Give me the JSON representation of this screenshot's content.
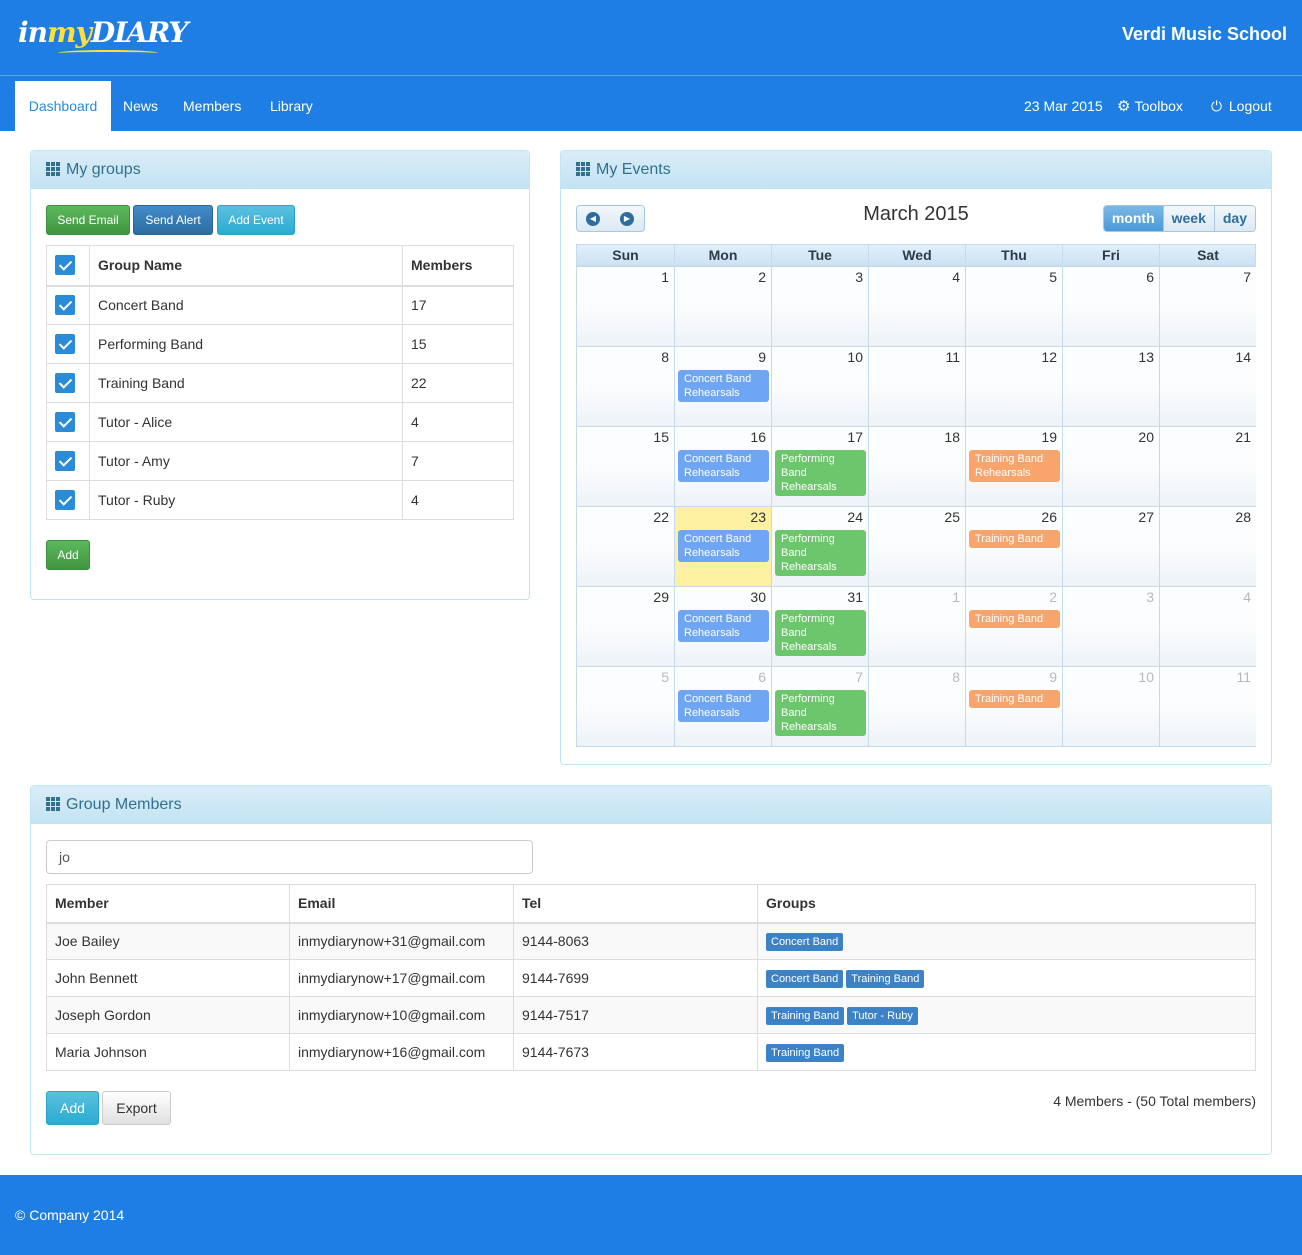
{
  "header": {
    "logo": {
      "part1": "in",
      "part2": "my",
      "part3": "DIARY"
    },
    "school_name": "Verdi Music School"
  },
  "nav": {
    "items": [
      {
        "label": "Dashboard"
      },
      {
        "label": "News"
      },
      {
        "label": "Members"
      },
      {
        "label": "Library"
      }
    ],
    "date": "23 Mar 2015",
    "toolbox": "Toolbox",
    "logout": "Logout"
  },
  "groups_panel": {
    "title": "My groups",
    "buttons": {
      "send_email": "Send Email",
      "send_alert": "Send Alert",
      "add_event": "Add Event",
      "add": "Add"
    },
    "columns": {
      "name": "Group Name",
      "members": "Members"
    },
    "rows": [
      {
        "name": "Concert Band",
        "members": "17"
      },
      {
        "name": "Performing Band",
        "members": "15"
      },
      {
        "name": "Training Band",
        "members": "22"
      },
      {
        "name": "Tutor - Alice",
        "members": "4"
      },
      {
        "name": "Tutor - Amy",
        "members": "7"
      },
      {
        "name": "Tutor - Ruby",
        "members": "4"
      }
    ]
  },
  "events_panel": {
    "title": "My Events",
    "month_title": "March 2015",
    "views": {
      "month": "month",
      "week": "week",
      "day": "day"
    },
    "weekdays": [
      "Sun",
      "Mon",
      "Tue",
      "Wed",
      "Thu",
      "Fri",
      "Sat"
    ],
    "weeks": [
      [
        {
          "d": "1"
        },
        {
          "d": "2"
        },
        {
          "d": "3"
        },
        {
          "d": "4"
        },
        {
          "d": "5"
        },
        {
          "d": "6"
        },
        {
          "d": "7"
        }
      ],
      [
        {
          "d": "8"
        },
        {
          "d": "9",
          "ev": "Concert Band Rehearsals",
          "c": "blue"
        },
        {
          "d": "10"
        },
        {
          "d": "11"
        },
        {
          "d": "12"
        },
        {
          "d": "13"
        },
        {
          "d": "14"
        }
      ],
      [
        {
          "d": "15"
        },
        {
          "d": "16",
          "ev": "Concert Band Rehearsals",
          "c": "blue"
        },
        {
          "d": "17",
          "ev": "Performing Band Rehearsals",
          "c": "green"
        },
        {
          "d": "18"
        },
        {
          "d": "19",
          "ev": "Training Band Rehearsals",
          "c": "orange"
        },
        {
          "d": "20"
        },
        {
          "d": "21"
        }
      ],
      [
        {
          "d": "22"
        },
        {
          "d": "23",
          "today": true,
          "ev": "Concert Band Rehearsals",
          "c": "blue"
        },
        {
          "d": "24",
          "ev": "Performing Band Rehearsals",
          "c": "green"
        },
        {
          "d": "25"
        },
        {
          "d": "26",
          "ev": "Training Band",
          "c": "orange"
        },
        {
          "d": "27"
        },
        {
          "d": "28"
        }
      ],
      [
        {
          "d": "29"
        },
        {
          "d": "30",
          "ev": "Concert Band Rehearsals",
          "c": "blue"
        },
        {
          "d": "31",
          "ev": "Performing Band Rehearsals",
          "c": "green"
        },
        {
          "d": "1",
          "other": true
        },
        {
          "d": "2",
          "other": true,
          "ev": "Training Band",
          "c": "orange"
        },
        {
          "d": "3",
          "other": true
        },
        {
          "d": "4",
          "other": true
        }
      ],
      [
        {
          "d": "5",
          "other": true
        },
        {
          "d": "6",
          "other": true,
          "ev": "Concert Band Rehearsals",
          "c": "blue"
        },
        {
          "d": "7",
          "other": true,
          "ev": "Performing Band Rehearsals",
          "c": "green"
        },
        {
          "d": "8",
          "other": true
        },
        {
          "d": "9",
          "other": true,
          "ev": "Training Band",
          "c": "orange"
        },
        {
          "d": "10",
          "other": true
        },
        {
          "d": "11",
          "other": true
        }
      ]
    ]
  },
  "members_panel": {
    "title": "Group Members",
    "search_value": "jo",
    "columns": {
      "member": "Member",
      "email": "Email",
      "tel": "Tel",
      "groups": "Groups"
    },
    "rows": [
      {
        "member": "Joe Bailey",
        "email": "inmydiarynow+31@gmail.com",
        "tel": "9144-8063",
        "groups": [
          "Concert Band"
        ]
      },
      {
        "member": "John Bennett",
        "email": "inmydiarynow+17@gmail.com",
        "tel": "9144-7699",
        "groups": [
          "Concert Band",
          "Training Band"
        ]
      },
      {
        "member": "Joseph Gordon",
        "email": "inmydiarynow+10@gmail.com",
        "tel": "9144-7517",
        "groups": [
          "Training Band",
          "Tutor - Ruby"
        ]
      },
      {
        "member": "Maria Johnson",
        "email": "inmydiarynow+16@gmail.com",
        "tel": "9144-7673",
        "groups": [
          "Training Band"
        ]
      }
    ],
    "buttons": {
      "add": "Add",
      "export": "Export"
    },
    "summary": "4 Members - (50 Total members)"
  },
  "footer": {
    "text": "© Company 2014"
  }
}
